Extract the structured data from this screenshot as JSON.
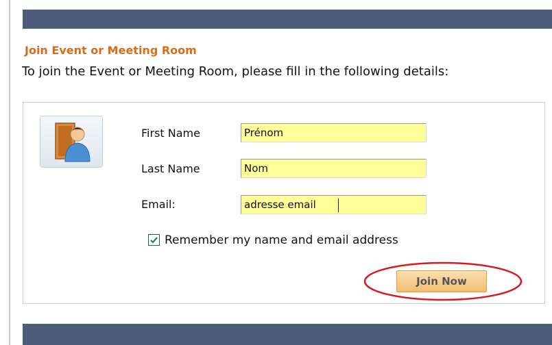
{
  "section_title": "Join Event or Meeting Room",
  "intro_text": "To join the Event or Meeting Room, please fill in the following details:",
  "icons": {
    "avatar": "user-door-icon",
    "checkbox": "checkmark-icon"
  },
  "colors": {
    "header_bar": "#4b5d78",
    "title_accent": "#d96c18",
    "input_background": "#ffff99",
    "button_background": "#f3bd73",
    "highlight_ellipse": "#d9191c"
  },
  "form": {
    "first_name": {
      "label": "First Name",
      "value": "Prénom"
    },
    "last_name": {
      "label": "Last Name",
      "value": "Nom"
    },
    "email": {
      "label": "Email:",
      "value": "adresse email"
    },
    "remember": {
      "label": "Remember my name and email address",
      "checked": true
    },
    "submit_label": "Join Now"
  }
}
